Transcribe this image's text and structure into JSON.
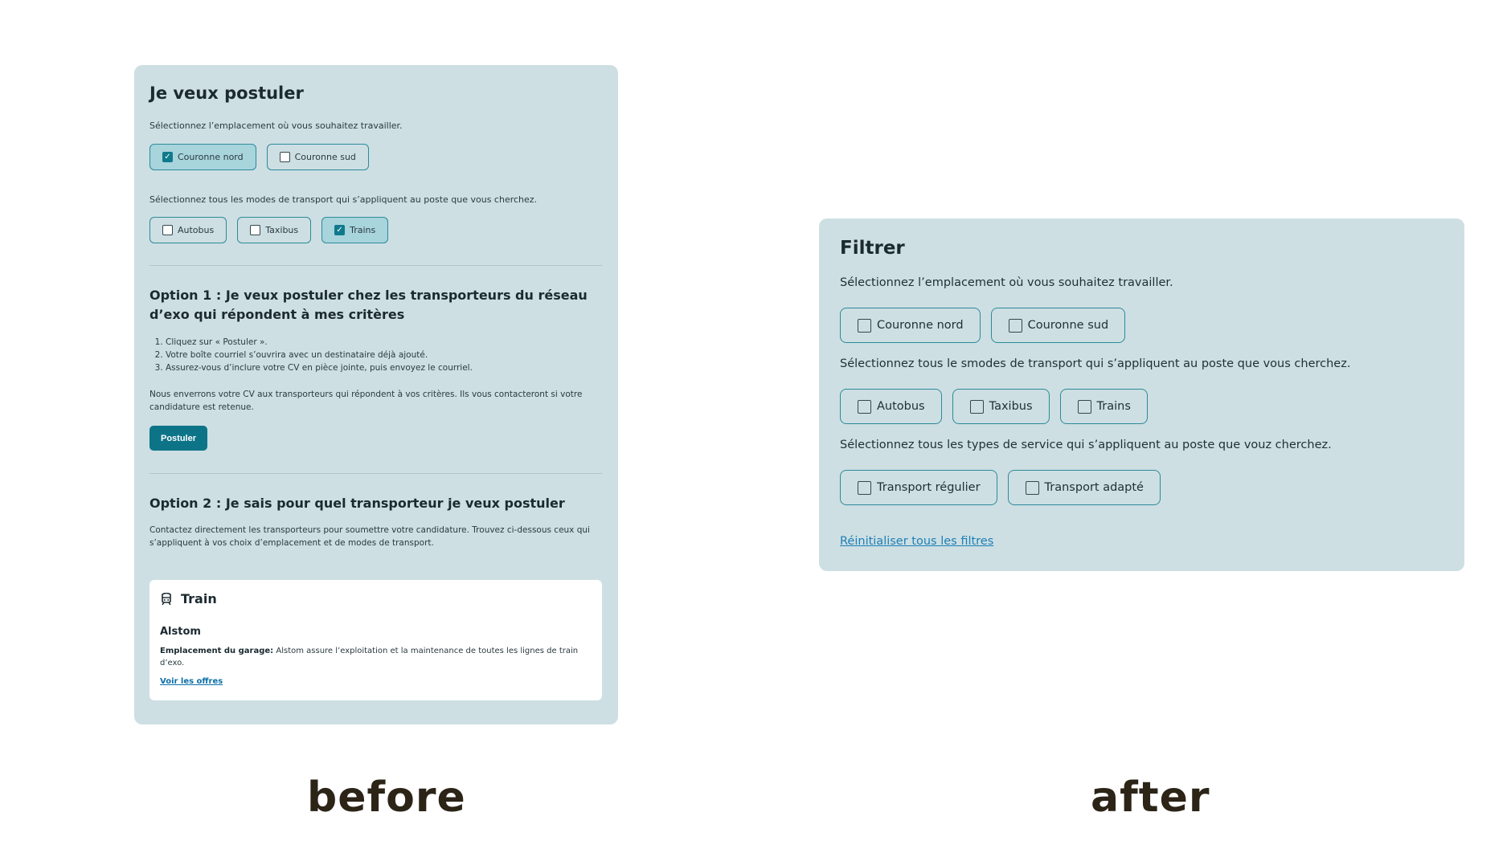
{
  "before": {
    "title": "Je veux postuler",
    "location_prompt": "Sélectionnez l’emplacement où vous souhaitez travailler.",
    "locations": [
      {
        "label": "Couronne nord",
        "checked": true
      },
      {
        "label": "Couronne sud",
        "checked": false
      }
    ],
    "transport_prompt": "Sélectionnez tous les modes de transport qui s’appliquent au poste que vous cherchez.",
    "transports": [
      {
        "label": "Autobus",
        "checked": false
      },
      {
        "label": "Taxibus",
        "checked": false
      },
      {
        "label": "Trains",
        "checked": true
      }
    ],
    "option1_title": "Option 1 : Je veux postuler chez les transporteurs du réseau d’exo qui répondent à mes critères",
    "option1_steps": [
      "Cliquez sur « Postuler ».",
      "Votre boîte courriel s’ouvrira avec un destinataire déjà ajouté.",
      "Assurez-vous d’inclure votre CV en pièce jointe, puis envoyez le courriel."
    ],
    "option1_note": "Nous enverrons votre CV aux transporteurs qui répondent à vos critères. Ils vous contacteront si votre candidature est retenue.",
    "apply_button": "Postuler",
    "option2_title": "Option 2 : Je sais pour quel transporteur je veux postuler",
    "option2_note": "Contactez directement les transporteurs pour soumettre votre candidature. Trouvez ci-dessous ceux qui s’appliquent à vos choix d’emplacement et de modes de transport.",
    "card": {
      "icon": "train-icon",
      "mode": "Train",
      "operator": "Alstom",
      "garage_label": "Emplacement du garage:",
      "garage_text": "Alstom assure l’exploitation et la maintenance de toutes les lignes de train d’exo.",
      "link": "Voir les offres"
    }
  },
  "after": {
    "title": "Filtrer",
    "location_prompt": "Sélectionnez l’emplacement où vous souhaitez travailler.",
    "locations": [
      "Couronne nord",
      "Couronne sud"
    ],
    "transport_prompt": "Sélectionnez tous le smodes de transport qui s’appliquent au poste que vous cherchez.",
    "transports": [
      "Autobus",
      "Taxibus",
      "Trains"
    ],
    "service_prompt": "Sélectionnez tous les types de service qui s’appliquent au poste que vouz cherchez.",
    "services": [
      "Transport régulier",
      "Transport adapté"
    ],
    "reset_link": "Réinitialiser tous les filtres"
  },
  "captions": {
    "before": "before",
    "after": "after"
  },
  "colors": {
    "panel_bg": "#cddfe3",
    "chip_border": "#2c8a9a",
    "checked_chip_bg": "#a8d4dc",
    "primary_button": "#0d7488",
    "link": "#1d7fb5",
    "caption": "#2b2417"
  }
}
